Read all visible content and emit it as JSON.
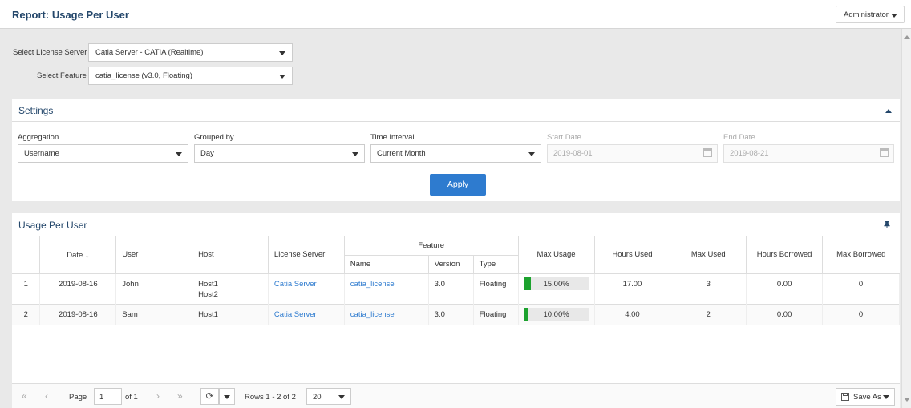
{
  "header": {
    "title": "Report: Usage Per User",
    "user_menu": "Administrator"
  },
  "selectors": {
    "server_label": "Select License Server",
    "server_value": "Catia Server - CATIA (Realtime)",
    "feature_label": "Select Feature",
    "feature_value": "catia_license (v3.0, Floating)"
  },
  "settings": {
    "title": "Settings",
    "aggregation_label": "Aggregation",
    "aggregation_value": "Username",
    "grouped_label": "Grouped by",
    "grouped_value": "Day",
    "interval_label": "Time Interval",
    "interval_value": "Current Month",
    "start_label": "Start Date",
    "start_value": "2019-08-01",
    "end_label": "End Date",
    "end_value": "2019-08-21",
    "apply": "Apply"
  },
  "usage": {
    "title": "Usage Per User",
    "headers": {
      "date": "Date",
      "user": "User",
      "host": "Host",
      "server": "License Server",
      "feature": "Feature",
      "name": "Name",
      "version": "Version",
      "type": "Type",
      "max_usage": "Max Usage",
      "hours_used": "Hours Used",
      "max_used": "Max Used",
      "hours_borrowed": "Hours Borrowed",
      "max_borrowed": "Max Borrowed"
    },
    "rows": [
      {
        "num": "1",
        "date": "2019-08-16",
        "user": "John",
        "host1": "Host1",
        "host2": "Host2",
        "server": "Catia Server",
        "name": "catia_license",
        "version": "3.0",
        "type": "Floating",
        "pct": "15.00%",
        "frac": 0.15,
        "hours_used": "17.00",
        "max_used": "3",
        "hours_borrowed": "0.00",
        "max_borrowed": "0"
      },
      {
        "num": "2",
        "date": "2019-08-16",
        "user": "Sam",
        "host1": "Host1",
        "host2": "",
        "server": "Catia Server",
        "name": "catia_license",
        "version": "3.0",
        "type": "Floating",
        "pct": "10.00%",
        "frac": 0.1,
        "hours_used": "4.00",
        "max_used": "2",
        "hours_borrowed": "0.00",
        "max_borrowed": "0"
      }
    ]
  },
  "pager": {
    "page_label": "Page",
    "page_value": "1",
    "of": "of 1",
    "rows": "Rows 1 - 2 of 2",
    "size": "20",
    "save": "Save As"
  },
  "colors": {
    "accent": "#2e7bcf",
    "title": "#24476b",
    "bar": "#1ca22e"
  }
}
